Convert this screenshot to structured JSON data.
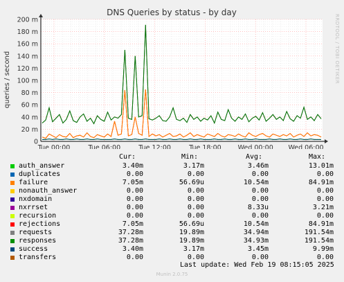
{
  "chart_data": {
    "type": "line",
    "title": "DNS Queries by status - by day",
    "ylabel": "queries / second",
    "ylim": [
      0,
      200
    ],
    "y_ticks": [
      "0",
      "20 m",
      "40 m",
      "60 m",
      "80 m",
      "100 m",
      "120 m",
      "140 m",
      "160 m",
      "180 m",
      "200 m"
    ],
    "x_ticks": [
      "Tue 00:00",
      "Tue 06:00",
      "Tue 12:00",
      "Tue 18:00",
      "Wed 00:00",
      "Wed 06:00"
    ],
    "grid": true,
    "units": "milli queries/second",
    "series": [
      {
        "name": "auth_answer",
        "color": "#00cc00",
        "values": [
          3,
          3,
          4,
          3,
          4,
          3,
          3,
          4,
          3,
          3,
          4,
          3,
          3,
          4,
          3,
          3,
          4,
          3,
          3,
          3,
          3,
          4,
          3,
          3,
          4,
          3,
          3,
          4,
          3,
          3,
          4,
          3,
          3,
          3,
          4,
          3,
          3,
          4,
          3,
          3,
          4,
          3,
          3,
          4,
          3,
          3,
          4,
          3,
          3,
          3,
          4,
          3,
          3,
          4,
          3,
          3,
          4,
          3,
          3,
          4,
          3,
          3,
          4,
          3,
          3,
          3,
          4,
          3,
          3,
          4,
          3,
          3,
          4,
          3,
          3,
          4,
          3,
          3,
          4,
          3,
          3,
          3
        ]
      },
      {
        "name": "failure",
        "color": "#ff8000",
        "values": [
          7,
          5,
          12,
          9,
          6,
          11,
          8,
          7,
          13,
          6,
          9,
          10,
          7,
          14,
          8,
          6,
          11,
          9,
          7,
          12,
          8,
          33,
          10,
          12,
          84,
          9,
          11,
          40,
          13,
          10,
          85,
          8,
          12,
          9,
          11,
          7,
          10,
          13,
          8,
          9,
          12,
          7,
          10,
          14,
          8,
          11,
          9,
          7,
          12,
          10,
          8,
          13,
          9,
          7,
          11,
          10,
          8,
          12,
          9,
          7,
          14,
          10,
          8,
          11,
          13,
          9,
          7,
          12,
          10,
          8,
          11,
          9,
          13,
          7,
          10,
          12,
          8,
          14,
          9,
          11,
          10,
          7
        ]
      },
      {
        "name": "rejections",
        "color": "#ff0000",
        "values": [
          7,
          5,
          12,
          9,
          6,
          11,
          8,
          7,
          13,
          6,
          9,
          10,
          7,
          14,
          8,
          6,
          11,
          9,
          7,
          12,
          8,
          33,
          10,
          12,
          84,
          9,
          11,
          40,
          13,
          10,
          85,
          8,
          12,
          9,
          11,
          7,
          10,
          13,
          8,
          9,
          12,
          7,
          10,
          14,
          8,
          11,
          9,
          7,
          12,
          10,
          8,
          13,
          9,
          7,
          11,
          10,
          8,
          12,
          9,
          7,
          14,
          10,
          8,
          11,
          13,
          9,
          7,
          12,
          10,
          8,
          11,
          9,
          13,
          7,
          10,
          12,
          8,
          14,
          9,
          11,
          10,
          7
        ]
      },
      {
        "name": "requests",
        "color": "#0a6e0a",
        "values": [
          30,
          35,
          55,
          32,
          38,
          44,
          30,
          36,
          50,
          34,
          31,
          40,
          45,
          33,
          38,
          29,
          42,
          36,
          33,
          48,
          35,
          40,
          38,
          44,
          150,
          38,
          36,
          140,
          40,
          42,
          191,
          37,
          35,
          38,
          42,
          34,
          33,
          40,
          55,
          36,
          34,
          38,
          31,
          44,
          36,
          40,
          33,
          38,
          35,
          42,
          30,
          48,
          36,
          34,
          52,
          38,
          33,
          40,
          36,
          45,
          32,
          38,
          41,
          35,
          47,
          33,
          38,
          44,
          36,
          40,
          34,
          49,
          37,
          33,
          42,
          38,
          56,
          36,
          40,
          34,
          44,
          37
        ]
      },
      {
        "name": "responses",
        "color": "#1e961e",
        "values": [
          30,
          35,
          55,
          32,
          38,
          44,
          30,
          36,
          50,
          34,
          31,
          40,
          45,
          33,
          38,
          29,
          42,
          36,
          33,
          48,
          35,
          40,
          38,
          44,
          150,
          38,
          36,
          140,
          40,
          42,
          191,
          37,
          35,
          38,
          42,
          34,
          33,
          40,
          55,
          36,
          34,
          38,
          31,
          44,
          36,
          40,
          33,
          38,
          35,
          42,
          30,
          48,
          36,
          34,
          52,
          38,
          33,
          40,
          36,
          45,
          32,
          38,
          41,
          35,
          47,
          33,
          38,
          44,
          36,
          40,
          34,
          49,
          37,
          33,
          42,
          38,
          56,
          36,
          40,
          34,
          44,
          37
        ]
      },
      {
        "name": "success",
        "color": "#004060",
        "values": [
          3,
          3,
          4,
          3,
          4,
          3,
          3,
          4,
          3,
          3,
          4,
          3,
          3,
          4,
          3,
          3,
          4,
          3,
          3,
          3,
          3,
          4,
          3,
          3,
          4,
          3,
          3,
          4,
          3,
          3,
          4,
          3,
          3,
          3,
          4,
          3,
          3,
          4,
          3,
          3,
          4,
          3,
          3,
          4,
          3,
          3,
          4,
          3,
          3,
          3,
          4,
          3,
          3,
          4,
          3,
          3,
          4,
          3,
          3,
          4,
          3,
          3,
          4,
          3,
          3,
          3,
          4,
          3,
          3,
          4,
          3,
          3,
          4,
          3,
          3,
          4,
          3,
          3,
          4,
          3,
          3,
          3
        ]
      }
    ]
  },
  "legend": {
    "headers": {
      "cur": "Cur:",
      "min": "Min:",
      "avg": "Avg:",
      "max": "Max:"
    },
    "rows": [
      {
        "label": "auth_answer",
        "color": "#00cc00",
        "cur": "3.40m",
        "min": "3.17m",
        "avg": "3.46m",
        "max": "13.01m"
      },
      {
        "label": "duplicates",
        "color": "#0066b3",
        "cur": "0.00",
        "min": "0.00",
        "avg": "0.00",
        "max": "0.00"
      },
      {
        "label": "failure",
        "color": "#ff8000",
        "cur": "7.05m",
        "min": "56.69u",
        "avg": "10.54m",
        "max": "84.91m"
      },
      {
        "label": "nonauth_answer",
        "color": "#ffcc00",
        "cur": "0.00",
        "min": "0.00",
        "avg": "0.00",
        "max": "0.00"
      },
      {
        "label": "nxdomain",
        "color": "#330099",
        "cur": "0.00",
        "min": "0.00",
        "avg": "0.00",
        "max": "0.00"
      },
      {
        "label": "nxrrset",
        "color": "#990099",
        "cur": "0.00",
        "min": "0.00",
        "avg": "8.33u",
        "max": "3.21m"
      },
      {
        "label": "recursion",
        "color": "#ccff00",
        "cur": "0.00",
        "min": "0.00",
        "avg": "0.00",
        "max": "0.00"
      },
      {
        "label": "rejections",
        "color": "#ff0000",
        "cur": "7.05m",
        "min": "56.69u",
        "avg": "10.54m",
        "max": "84.91m"
      },
      {
        "label": "requests",
        "color": "#808080",
        "cur": "37.28m",
        "min": "19.89m",
        "avg": "34.94m",
        "max": "191.54m"
      },
      {
        "label": "responses",
        "color": "#008f00",
        "cur": "37.28m",
        "min": "19.89m",
        "avg": "34.93m",
        "max": "191.54m"
      },
      {
        "label": "success",
        "color": "#00487d",
        "cur": "3.40m",
        "min": "3.17m",
        "avg": "3.45m",
        "max": "9.99m"
      },
      {
        "label": "transfers",
        "color": "#b35a00",
        "cur": "0.00",
        "min": "0.00",
        "avg": "0.00",
        "max": "0.00"
      }
    ]
  },
  "footer": {
    "last_update": "Last update: Wed Feb 19 08:15:05 2025",
    "version": "Munin 2.0.75"
  },
  "side_tag": "RRDTOOL / TOBI OETIKER"
}
